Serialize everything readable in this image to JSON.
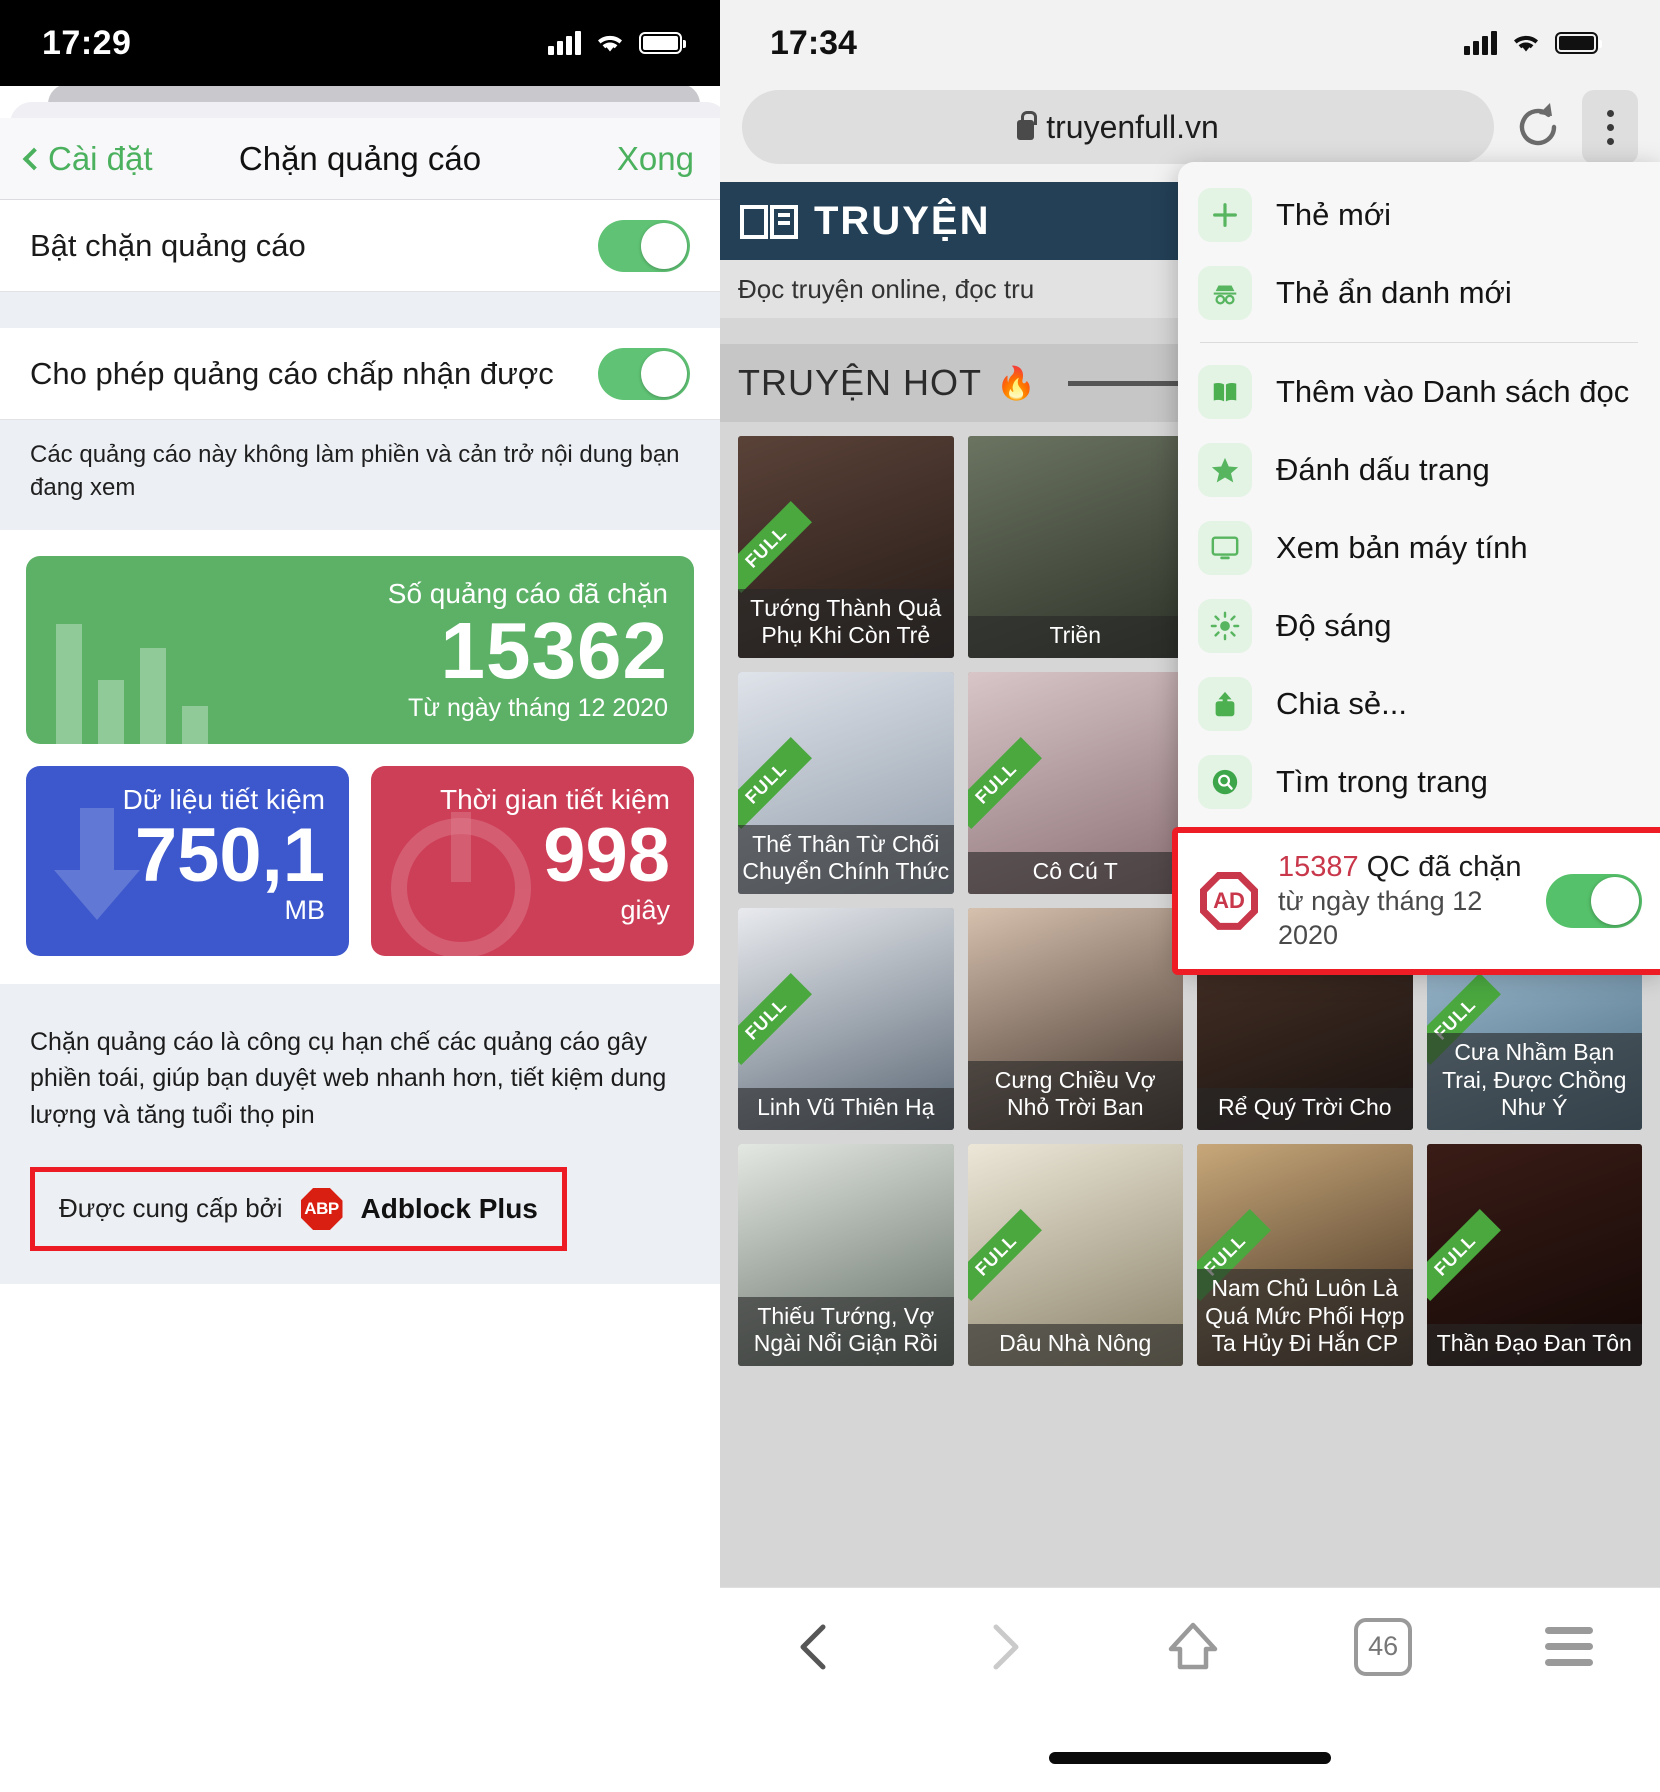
{
  "left": {
    "status": {
      "time": "17:29"
    },
    "nav": {
      "back_label": "Cài đặt",
      "title": "Chặn quảng cáo",
      "done_label": "Xong"
    },
    "rows": [
      {
        "label": "Bật chặn quảng cáo",
        "toggle": "on"
      },
      {
        "label": "Cho phép quảng cáo chấp nhận được",
        "toggle": "on"
      }
    ],
    "note": "Các quảng cáo này không làm phiền và cản trở nội dung bạn đang xem",
    "stats": {
      "blocked": {
        "caption": "Số quảng cáo đã chặn",
        "value": "15362",
        "since": "Từ ngày tháng 12 2020"
      },
      "data": {
        "caption": "Dữ liệu tiết kiệm",
        "value": "750,1",
        "unit": "MB"
      },
      "time": {
        "caption": "Thời gian tiết kiệm",
        "value": "998",
        "unit": "giây"
      }
    },
    "footer": {
      "description": "Chặn quảng cáo là công cụ hạn chế các quảng cáo gây phiền toái, giúp bạn duyệt web nhanh hơn, tiết kiệm dung lượng và tăng tuổi thọ pin",
      "powered_by_label": "Được cung cấp bởi",
      "brand_badge": "ABP",
      "brand_name": "Adblock Plus"
    }
  },
  "right": {
    "status": {
      "time": "17:34"
    },
    "urlbar": {
      "url": "truyenfull.vn",
      "lock_icon": "lock-icon",
      "reload_icon": "reload-icon",
      "menu_icon": "kebab-menu-icon"
    },
    "site": {
      "name": "TRUYỆN",
      "tagline": "Đọc truyện online, đọc tru",
      "section_title": "TRUYỆN HOT",
      "section_icon": "flame-icon"
    },
    "books": [
      {
        "title": "Tướng Thành Quả Phụ Khi Còn Trẻ",
        "full": true,
        "c1": "#5a4238",
        "c2": "#241a16"
      },
      {
        "title": "Triền",
        "full": false,
        "c1": "#6b7361",
        "c2": "#2e3429"
      },
      {
        "title": "",
        "full": false,
        "c1": "#9b8f92",
        "c2": "#4a4045"
      },
      {
        "title": "",
        "full": false,
        "c1": "#7d8896",
        "c2": "#39424d"
      },
      {
        "title": "Thế Thân Từ Chối Chuyển Chính Thức",
        "full": true,
        "c1": "#dfe3ea",
        "c2": "#8e9aa8"
      },
      {
        "title": "Cô Cú T",
        "full": true,
        "c1": "#d8c6c8",
        "c2": "#8a6f74"
      },
      {
        "title": "",
        "full": false,
        "c1": "#b0a6a2",
        "c2": "#5c5350"
      },
      {
        "title": "",
        "full": false,
        "c1": "#c3bcb6",
        "c2": "#6a6158"
      },
      {
        "title": "Linh Vũ Thiên Hạ",
        "full": true,
        "c1": "#e8eaee",
        "c2": "#5a6775"
      },
      {
        "title": "Cưng Chiều Vợ Nhỏ Trời Ban",
        "full": false,
        "c1": "#d6c0ae",
        "c2": "#3e3028"
      },
      {
        "title": "Rể Quý Trời Cho",
        "full": false,
        "c1": "#4a3428",
        "c2": "#1a1210"
      },
      {
        "title": "Cưa Nhầm Bạn Trai, Được Chồng Như Ý",
        "full": true,
        "c1": "#a9c6d9",
        "c2": "#4a6b82"
      },
      {
        "title": "Thiếu Tướng, Vợ Ngài Nổi Giận Rồi",
        "full": false,
        "c1": "#e4e8e2",
        "c2": "#5e6a62"
      },
      {
        "title": "Dâu Nhà Nông",
        "full": true,
        "c1": "#ece7d8",
        "c2": "#8a8168"
      },
      {
        "title": "Nam Chủ Luôn Là Quá Mức Phối Hợp Ta Hủy Đi Hắn CP",
        "full": true,
        "c1": "#c8a87a",
        "c2": "#3c2a1c"
      },
      {
        "title": "Thần Đạo Đan Tôn",
        "full": true,
        "c1": "#3a1c16",
        "c2": "#120806"
      }
    ],
    "menu": {
      "items": [
        {
          "label": "Thẻ mới",
          "icon": "plus-icon"
        },
        {
          "label": "Thẻ ẩn danh mới",
          "icon": "incognito-icon"
        },
        {
          "label": "Thêm vào Danh sách đọc",
          "icon": "book-icon"
        },
        {
          "label": "Đánh dấu trang",
          "icon": "star-icon"
        },
        {
          "label": "Xem bản máy tính",
          "icon": "desktop-icon"
        },
        {
          "label": "Độ sáng",
          "icon": "brightness-icon"
        },
        {
          "label": "Chia sẻ...",
          "icon": "share-icon"
        },
        {
          "label": "Tìm trong trang",
          "icon": "search-icon"
        }
      ],
      "ad_row": {
        "icon": "ad-block-icon",
        "badge_text": "AD",
        "count": "15387",
        "label": "QC đã chặn",
        "since": "từ ngày tháng 12 2020",
        "toggle": "on"
      }
    },
    "bottombar": {
      "back_icon": "back-chevron-icon",
      "forward_icon": "forward-chevron-icon",
      "home_icon": "home-icon",
      "tab_count": "46",
      "menu_icon": "hamburger-icon"
    }
  },
  "colors": {
    "accent_green": "#4cb15e",
    "highlight_red": "#ee1c25",
    "stat_green": "#5cb167",
    "stat_blue": "#3c58cc",
    "stat_red": "#cd3f57"
  }
}
